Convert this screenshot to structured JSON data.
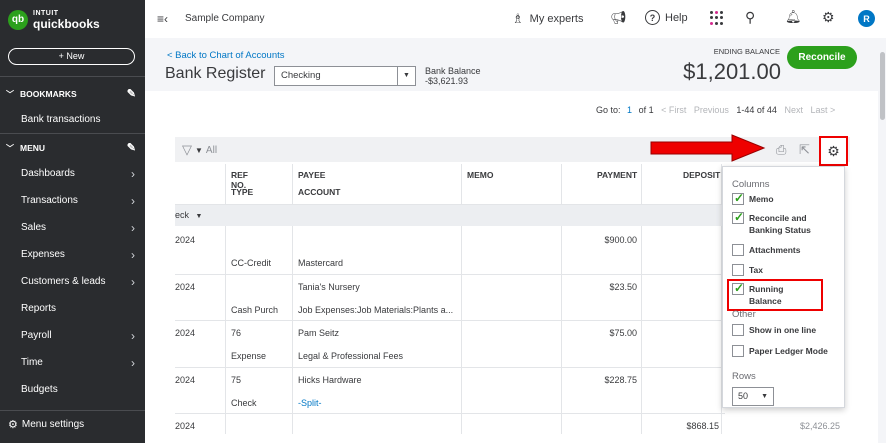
{
  "brand": {
    "logo_mark": "qb",
    "line1": "INTUIT",
    "line2": "quickbooks"
  },
  "sidebar": {
    "new_label": "+ New",
    "bookmarks_label": "BOOKMARKS",
    "bank_transactions": "Bank transactions",
    "menu_label": "MENU",
    "items": [
      {
        "label": "Dashboards",
        "arrow": true
      },
      {
        "label": "Transactions",
        "arrow": true
      },
      {
        "label": "Sales",
        "arrow": true
      },
      {
        "label": "Expenses",
        "arrow": true
      },
      {
        "label": "Customers & leads",
        "arrow": true
      },
      {
        "label": "Reports",
        "arrow": false
      },
      {
        "label": "Payroll",
        "arrow": true
      },
      {
        "label": "Time",
        "arrow": true
      },
      {
        "label": "Budgets",
        "arrow": false
      }
    ],
    "menu_settings": "Menu settings"
  },
  "topbar": {
    "company": "Sample Company",
    "experts": "My experts",
    "help": "Help",
    "avatar_initial": "R"
  },
  "header": {
    "back_link": "< Back to Chart of Accounts",
    "title": "Bank Register",
    "account": "Checking",
    "bank_balance_label": "Bank Balance",
    "bank_balance_value": "-$3,621.93",
    "ending_balance_label": "ENDING BALANCE",
    "ending_balance_value": "$1,201.00",
    "reconcile_label": "Reconcile"
  },
  "pagination": {
    "goto": "Go to:",
    "page": "1",
    "of": "of 1",
    "first": "< First",
    "previous": "Previous",
    "range": "1-44 of 44",
    "next": "Next",
    "last": "Last >"
  },
  "filter": {
    "label": "All"
  },
  "columns": {
    "ref_no": "REF NO.",
    "type": "TYPE",
    "payee": "PAYEE",
    "account": "ACCOUNT",
    "memo": "MEMO",
    "payment": "PAYMENT",
    "deposit": "DEPOSIT"
  },
  "group_label": "eck",
  "rows": [
    {
      "date": "2024",
      "ref": "",
      "payee": "",
      "payment": "$900.00",
      "type": "CC-Credit",
      "account": "Mastercard",
      "account_link": false
    },
    {
      "date": "2024",
      "ref": "",
      "payee": "Tania's Nursery",
      "payment": "$23.50",
      "type": "Cash Purch",
      "account": "Job Expenses:Job Materials:Plants a...",
      "account_link": false
    },
    {
      "date": "2024",
      "ref": "76",
      "payee": "Pam Seitz",
      "payment": "$75.00",
      "type": "Expense",
      "account": "Legal & Professional Fees",
      "account_link": false
    },
    {
      "date": "2024",
      "ref": "75",
      "payee": "Hicks Hardware",
      "payment": "$228.75",
      "type": "Check",
      "account": "-Split-",
      "account_link": true
    }
  ],
  "last_row": {
    "date": "2024",
    "deposit": "$868.15",
    "balance": "$2,426.25"
  },
  "settings_panel": {
    "columns_label": "Columns",
    "options": [
      {
        "label": "Memo",
        "checked": true
      },
      {
        "label": "Reconcile and Banking Status",
        "checked": true
      },
      {
        "label": "Attachments",
        "checked": false
      },
      {
        "label": "Tax",
        "checked": false
      },
      {
        "label": "Running Balance",
        "checked": true
      }
    ],
    "other_label": "Other",
    "other_options": [
      {
        "label": "Show in one line",
        "checked": false
      },
      {
        "label": "Paper Ledger Mode",
        "checked": false
      }
    ],
    "rows_label": "Rows",
    "rows_value": "50"
  },
  "colors": {
    "brand_green": "#2ca01c",
    "link_blue": "#0077c5",
    "highlight_red": "#e00000",
    "sidebar_bg": "#2a2c2f"
  },
  "icons": [
    "menu-toggle-icon",
    "experts-icon",
    "megaphone-icon",
    "help-icon",
    "apps-icon",
    "search-icon",
    "bell-icon",
    "gear-icon",
    "filter-icon",
    "print-icon",
    "export-icon",
    "pencil-icon",
    "chevron-down-icon",
    "chevron-right-icon"
  ]
}
